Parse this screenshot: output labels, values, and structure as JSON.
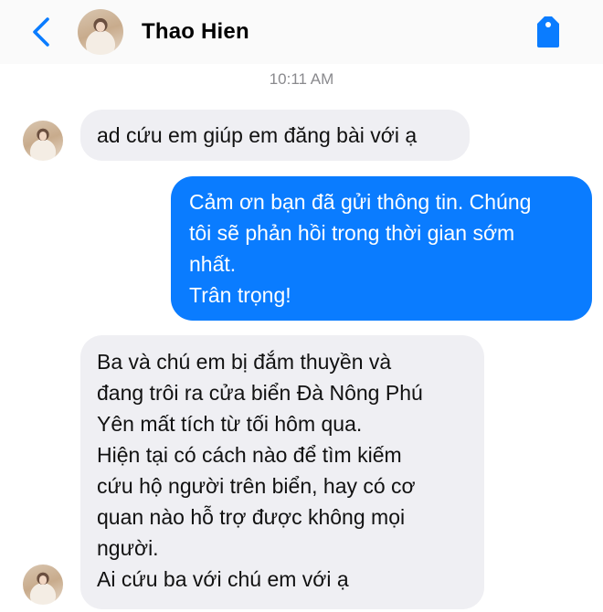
{
  "header": {
    "contact_name": "Thao Hien",
    "back_icon": "chevron-left-icon",
    "tag_icon": "tag-icon",
    "accent_color": "#0a7cff"
  },
  "timestamp": "10:11 AM",
  "messages": [
    {
      "from": "contact",
      "lines": [
        "ad cứu em giúp em đăng bài với ạ"
      ]
    },
    {
      "from": "me",
      "lines": [
        "Cảm ơn bạn đã gửi thông tin. Chúng",
        "tôi sẽ phản hồi trong thời gian sớm",
        "nhất.",
        "Trân trọng!"
      ]
    },
    {
      "from": "contact",
      "lines": [
        "Ba và chú em bị đắm thuyền và",
        "đang trôi ra cửa biển Đà Nông Phú",
        "Yên mất tích từ tối hôm qua.",
        "Hiện tại có cách nào để tìm kiếm",
        "cứu hộ người trên biển, hay có cơ",
        "quan nào hỗ trợ được không mọi",
        "người.",
        "Ai cứu ba với chú em với ạ"
      ]
    }
  ]
}
